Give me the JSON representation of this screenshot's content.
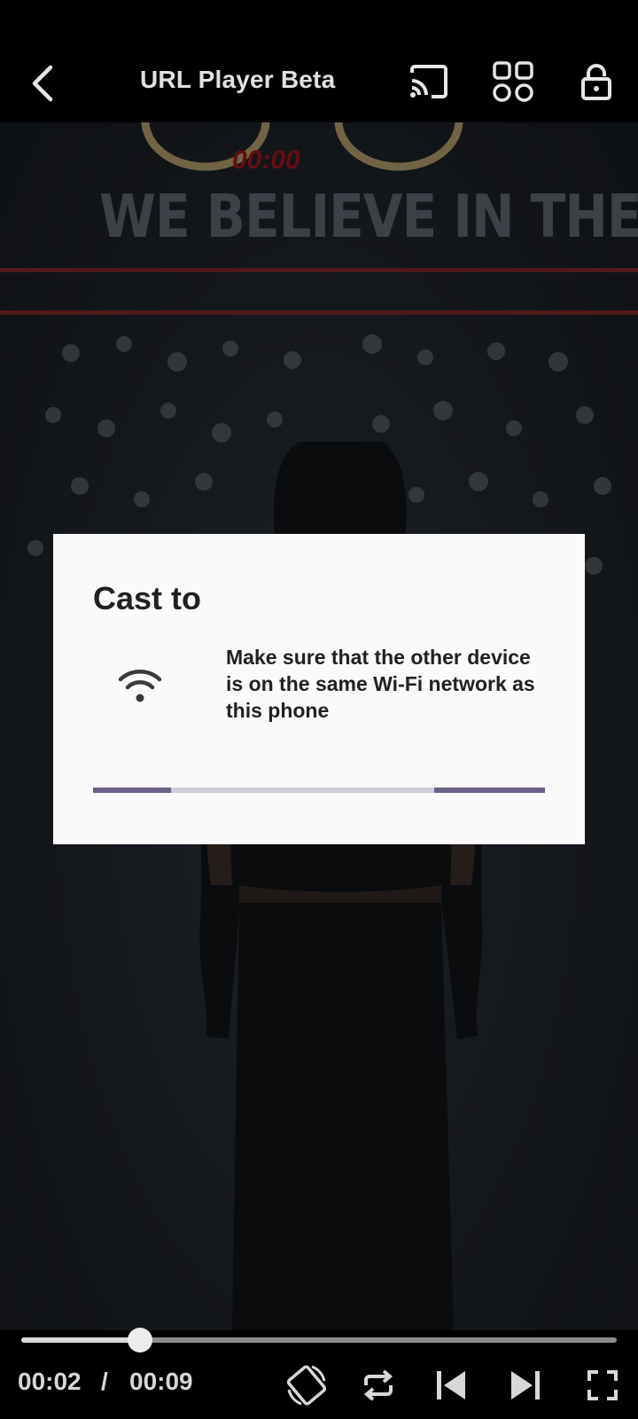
{
  "header": {
    "title": "URL Player Beta",
    "icons": [
      "back-arrow-icon",
      "cast-icon",
      "apps-grid-icon",
      "lock-icon"
    ]
  },
  "dialog": {
    "title": "Cast to",
    "message": "Make sure that the other device is on the same Wi-Fi network as this phone",
    "icon": "wifi-icon"
  },
  "background": {
    "wall_text": "WE BELIEVE IN THE POWER OF",
    "clock_text": "00:00"
  },
  "player": {
    "current_time": "00:02",
    "separator": "/",
    "duration": "00:09",
    "progress_fraction": 0.2,
    "controls": [
      "rotate-icon",
      "repeat-icon",
      "previous-icon",
      "next-icon",
      "fullscreen-icon"
    ]
  },
  "colors": {
    "dialog_background": "#fafafa",
    "progress_accent": "#6a5f85",
    "progress_track": "#cfcbd8"
  }
}
